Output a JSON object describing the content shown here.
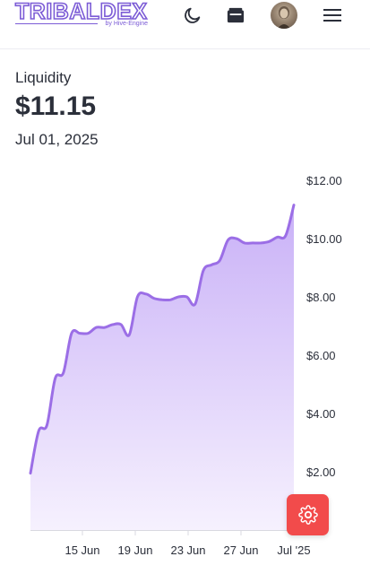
{
  "header": {
    "logo_text": "TRIBALDEX",
    "logo_subtext": "by Hive-Engine",
    "icons": [
      "moon-icon",
      "wallet-icon",
      "avatar",
      "hamburger-menu-icon"
    ]
  },
  "summary": {
    "label": "Liquidity",
    "value": "$11.15",
    "date": "Jul 01, 2025"
  },
  "colors": {
    "accent": "#9b6ee6",
    "fill_top": "#c9b1f7",
    "fill_bottom": "#f6f1fe",
    "fab": "#f24b4b"
  },
  "chart_data": {
    "type": "area",
    "x_ticks": [
      "15 Jun",
      "19 Jun",
      "23 Jun",
      "27 Jun",
      "Jul '25"
    ],
    "y_ticks": [
      "$12.00",
      "$10.00",
      "$8.00",
      "$6.00",
      "$4.00",
      "$2.00",
      "0"
    ],
    "ylim": [
      0,
      12
    ],
    "grid": false,
    "series": [
      {
        "values": [
          1.95,
          3.4,
          3.6,
          5.2,
          5.4,
          6.75,
          6.75,
          6.75,
          6.95,
          6.95,
          7.05,
          7.05,
          6.7,
          8.0,
          8.1,
          7.95,
          7.9,
          7.9,
          8.0,
          8.0,
          7.75,
          8.9,
          9.1,
          9.25,
          9.95,
          10.0,
          9.85,
          9.85,
          9.85,
          9.9,
          10.05,
          10.1,
          11.15
        ]
      }
    ]
  }
}
